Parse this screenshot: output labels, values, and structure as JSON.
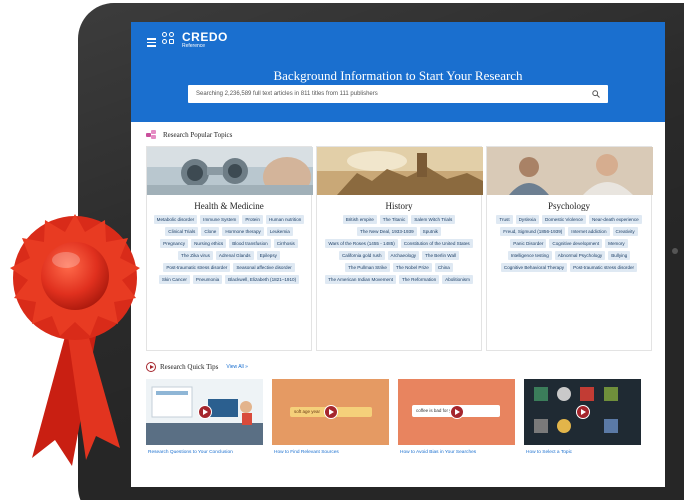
{
  "brand": {
    "title": "CREDO",
    "subtitle": "Reference"
  },
  "hero": {
    "title": "Background Information to Start Your Research"
  },
  "search": {
    "placeholder": "Searching 2,236,589 full text articles in 811 titles from 111 publishers"
  },
  "topics_section": {
    "title": "Research Popular Topics"
  },
  "topics": [
    {
      "title": "Health & Medicine",
      "tags": [
        "Metabolic disorder",
        "Immune System",
        "Protein",
        "Human nutrition",
        "Clinical Trials",
        "Clone",
        "Hormone therapy",
        "Leukemia",
        "Pregnancy",
        "Nursing ethics",
        "Blood transfusion",
        "Cirrhosis",
        "The Zika virus",
        "Adrenal Glands",
        "Epilepsy",
        "Post-traumatic stress disorder",
        "Seasonal affective disorder",
        "Skin Cancer",
        "Pneumonia",
        "Blackwell, Elizabeth (1821–1910)"
      ]
    },
    {
      "title": "History",
      "tags": [
        "British empire",
        "The Titanic",
        "Salem Witch Trials",
        "The New Deal, 1933-1939",
        "Sputnik",
        "Wars of the Roses (1455 - 1485)",
        "Constitution of the United States",
        "California gold rush",
        "Archaeology",
        "The Berlin Wall",
        "The Pullman Strike",
        "The Nobel Prize",
        "China",
        "The American Indian Movement",
        "The Reformation",
        "Abolitionism"
      ]
    },
    {
      "title": "Psychology",
      "tags": [
        "Trust",
        "Dyslexia",
        "Domestic Violence",
        "Near-death experience",
        "Freud, Sigmund (1856-1939)",
        "Internet addiction",
        "Creativity",
        "Panic Disorder",
        "Cognitive development",
        "Memory",
        "Intelligence testing",
        "Abnormal Psychology",
        "Bullying",
        "Cognitive Behavioral Therapy",
        "Post-traumatic stress disorder"
      ]
    }
  ],
  "tips_section": {
    "title": "Research Quick Tips",
    "view_all": "View All »"
  },
  "tips": [
    {
      "label": "Research Questions to Your Conclusion",
      "thumb_text": ""
    },
    {
      "label": "How to Find Relevant Sources",
      "thumb_text": "soft age year"
    },
    {
      "label": "How to Avoid Bias in Your Searches",
      "thumb_text": "coffee is bad for you"
    },
    {
      "label": "How to Select a Topic",
      "thumb_text": ""
    }
  ],
  "colors": {
    "header_blue": "#1a6fcf",
    "tag_bg": "#dfe9f3",
    "accent_red": "#a5262d",
    "ribbon_red": "#e0301e"
  }
}
